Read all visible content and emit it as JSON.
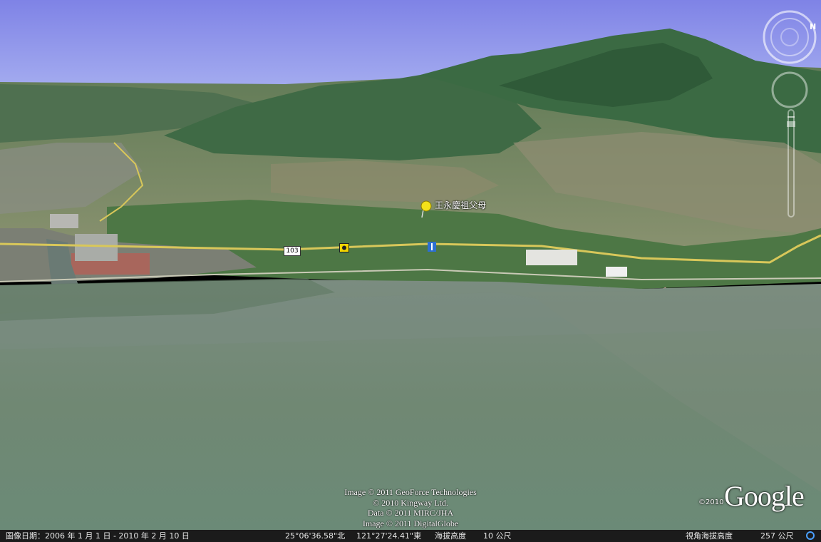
{
  "map": {
    "placemark": {
      "label": "王永慶祖父母",
      "icon": "yellow-pushpin-icon"
    },
    "road_shield": "103",
    "icons": [
      "camera-icon",
      "info-marker-icon"
    ],
    "compass_north": "N",
    "credits": [
      "Image © 2011 GeoForce Technologies",
      "© 2010 Kingway Ltd.",
      "Data © 2011 MIRC/JHA",
      "Image © 2011 DigitalGlobe"
    ],
    "logo": {
      "copyright": "©2010",
      "word": "Google"
    }
  },
  "status_bar": {
    "imagery_date": "圖像日期：2006 年 1 月  1 日 - 2010 年 2 月 10 日",
    "latitude": "25°06'36.58\"北",
    "longitude": "121°27'24.41\"東",
    "elevation_label": "海拔高度",
    "elevation_value": "10 公尺",
    "eye_alt_label": "視角海拔高度",
    "eye_alt_value": "257 公尺"
  },
  "colors": {
    "sky": "#8a8fe8",
    "water": "#6f8676",
    "mountain": "#3f6e45",
    "land": "#7d8a66"
  }
}
